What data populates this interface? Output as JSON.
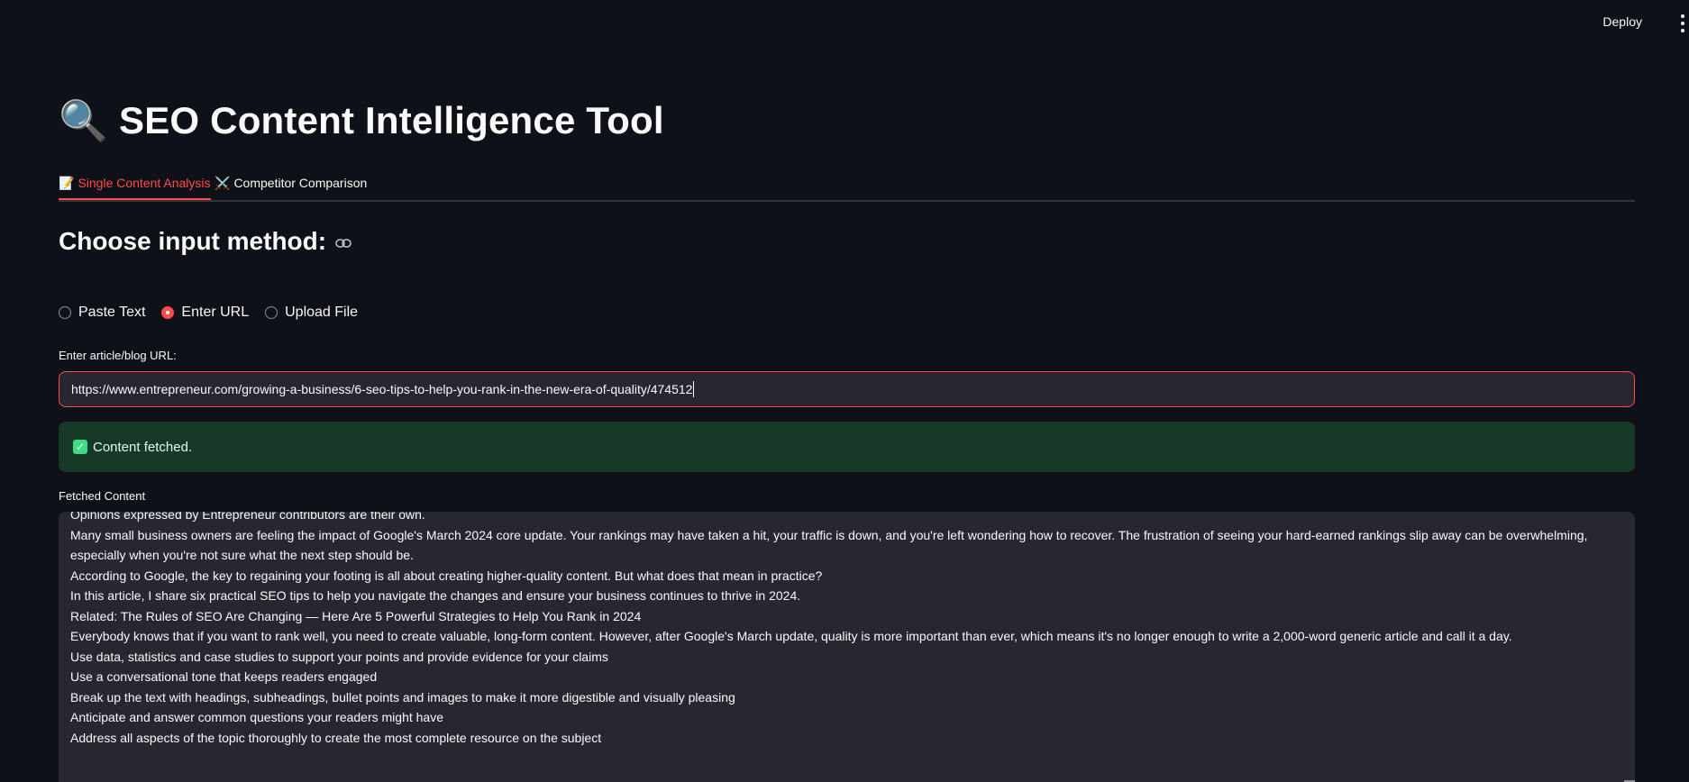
{
  "topbar": {
    "deploy_label": "Deploy",
    "menu_icon": "kebab-menu-icon"
  },
  "app": {
    "title_emoji": "🔍",
    "title": "SEO Content Intelligence Tool"
  },
  "tabs": [
    {
      "emoji": "📝",
      "label": "Single Content Analysis",
      "active": true
    },
    {
      "emoji": "⚔️",
      "label": "Competitor Comparison",
      "active": false
    }
  ],
  "input_method": {
    "heading": "Choose input method:",
    "options": [
      {
        "label": "Paste Text",
        "selected": false
      },
      {
        "label": "Enter URL",
        "selected": true
      },
      {
        "label": "Upload File",
        "selected": false
      }
    ]
  },
  "url_field": {
    "label": "Enter article/blog URL:",
    "value": "https://www.entrepreneur.com/growing-a-business/6-seo-tips-to-help-you-rank-in-the-new-era-of-quality/474512"
  },
  "status": {
    "message": "Content fetched.",
    "icon": "check-mark-icon",
    "color": "#173928"
  },
  "fetched": {
    "label": "Fetched Content",
    "lines": [
      "   Opinions expressed by Entrepreneur contributors are their own.",
      "Many small business owners are feeling the impact of Google's March 2024 core update. Your rankings may have taken a hit, your traffic is down, and you're left wondering how to recover. The frustration of seeing your hard-earned rankings slip away can be overwhelming, especially when you're not sure what the next step should be.",
      "According to Google, the key to regaining your footing is all about creating higher-quality content. But what does that mean in practice?",
      "In this article, I share six practical SEO tips to help you navigate the changes and ensure your business continues to thrive in 2024.",
      "Related: The Rules of SEO Are Changing — Here Are 5 Powerful Strategies to Help You Rank in 2024",
      "Everybody knows that if you want to rank well, you need to create valuable, long-form content. However, after Google's March update, quality is more important than ever, which means it's no longer enough to write a 2,000-word generic article and call it a day.",
      "Use data, statistics and case studies to support your points and provide evidence for your claims",
      "Use a conversational tone that keeps readers engaged",
      "Break up the text with headings, subheadings, bullet points and images to make it more digestible and visually pleasing",
      "Anticipate and answer common questions your readers might have",
      "Address all aspects of the topic thoroughly to create the most complete resource on the subject"
    ]
  },
  "colors": {
    "accent": "#ff4b4b",
    "background": "#0e1117",
    "input_bg": "#262730"
  }
}
